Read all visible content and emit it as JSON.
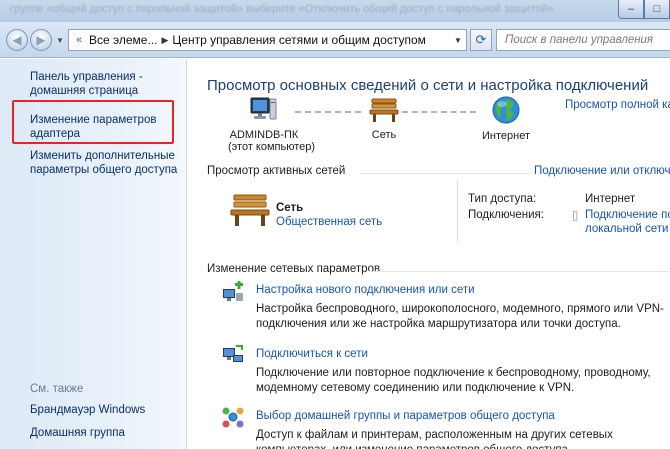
{
  "window": {
    "title_blurred": "группе «общий доступ с парольной защитой» выберите «Отключить общий доступ с парольной защитой»",
    "controls": [
      "–",
      "□"
    ]
  },
  "navbar": {
    "address_parts": [
      "Все элеме...",
      "Центр управления сетями и общим доступом"
    ],
    "search_placeholder": "Поиск в панели управления"
  },
  "sidebar": {
    "home_link": "Панель управления - домашняя страница",
    "adapter_link": "Изменение параметров адаптера",
    "sharing_link": "Изменить дополнительные параметры общего доступа",
    "see_also_title": "См. также",
    "see_also": [
      "Брандмауэр Windows",
      "Домашняя группа"
    ]
  },
  "main": {
    "title": "Просмотр основных сведений о сети и настройка подключений",
    "full_map_link": "Просмотр полной ка",
    "network_map": {
      "computer": {
        "name": "ADMINDB-ПК",
        "sub": "(этот компьютер)",
        "icon": "computer-icon"
      },
      "network": {
        "name": "Сеть",
        "icon": "bench-icon"
      },
      "internet": {
        "name": "Интернет",
        "icon": "globe-icon"
      }
    },
    "active_networks": {
      "title": "Просмотр активных сетей",
      "connect_link": "Подключение или отключ",
      "network_name": "Сеть",
      "network_type": "Общественная сеть",
      "access_type_label": "Тип доступа:",
      "access_type_value": "Интернет",
      "connections_label": "Подключения:",
      "connection_value_line1": "Подключение по",
      "connection_value_line2": "локальной сети"
    },
    "change_settings": {
      "title": "Изменение сетевых параметров",
      "tasks": [
        {
          "title": "Настройка нового подключения или сети",
          "desc": "Настройка беспроводного, широкополосного, модемного, прямого или VPN-подключения или же настройка маршрутизатора или точки доступа.",
          "icon": "new-connection-icon"
        },
        {
          "title": "Подключиться к сети",
          "desc": "Подключение или повторное подключение к беспроводному, проводному, модемному сетевому соединению или подключение к VPN.",
          "icon": "connect-network-icon"
        },
        {
          "title": "Выбор домашней группы и параметров общего доступа",
          "desc": "Доступ к файлам и принтерам, расположенным на других сетевых компьютерах, или изменение параметров общего доступа.",
          "icon": "homegroup-icon"
        }
      ]
    }
  }
}
